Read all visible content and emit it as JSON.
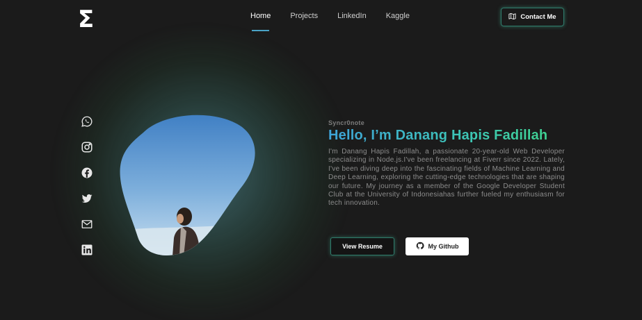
{
  "logo": {
    "symbol": "Σ"
  },
  "nav": {
    "items": [
      {
        "label": "Home",
        "active": true
      },
      {
        "label": "Projects"
      },
      {
        "label": "LinkedIn"
      },
      {
        "label": "Kaggle"
      }
    ],
    "contact_label": "Contact Me"
  },
  "social": [
    "whatsapp-icon",
    "instagram-icon",
    "facebook-icon",
    "twitter-icon",
    "mail-icon",
    "linkedin-icon"
  ],
  "hero": {
    "eyebrow": "Syncr0note",
    "headline": "Hello, I’m Danang Hapis Fadillah",
    "bio": "I'm Danang Hapis Fadillah, a passionate 20-year-old Web Developer specializing in Node.js.I've been freelancing at Fiverr since 2022. Lately, I've been diving deep into the fascinating fields of Machine Learning and Deep Learning, exploring the cutting-edge technologies that are shaping our future. My journey as a member of the Google Developer Student Club at the University of Indonesiahas further fueled my enthusiasm for tech innovation.",
    "resume_label": "View Resume",
    "github_label": "My Github"
  },
  "colors": {
    "background": "#1b1b1b",
    "accent_blue": "#3ea3d8",
    "accent_green": "#3fd48a",
    "button_glow": "#2f7c6c"
  }
}
